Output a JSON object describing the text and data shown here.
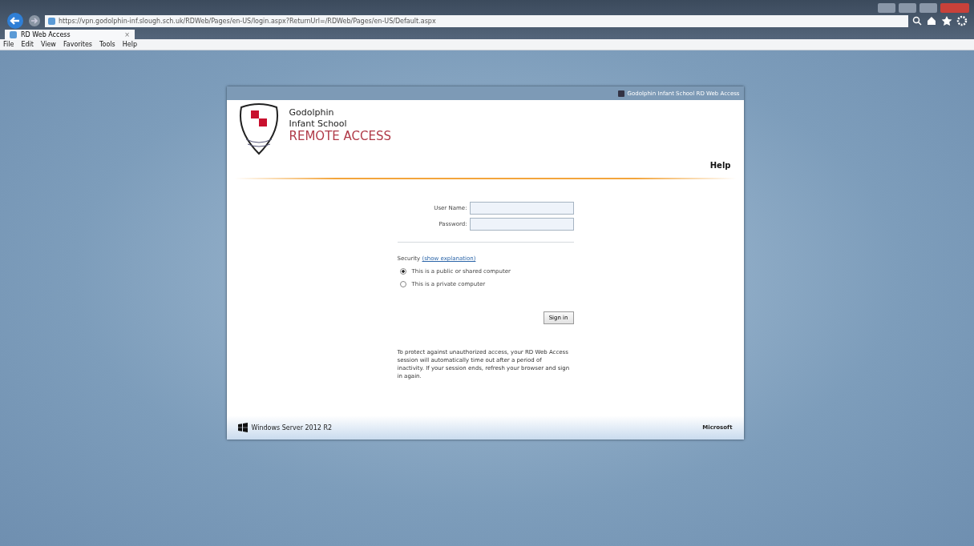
{
  "browser": {
    "url": "https://vpn.godolphin-inf.slough.sch.uk/RDWeb/Pages/en-US/login.aspx?ReturnUrl=/RDWeb/Pages/en-US/Default.aspx",
    "tabs": [
      {
        "label": "RD Web Access",
        "close": "×",
        "selected": true
      }
    ],
    "menu": [
      "File",
      "Edit",
      "View",
      "Favorites",
      "Tools",
      "Help"
    ]
  },
  "page": {
    "header_title": "Godolphin Infant School RD Web Access",
    "logo_lines": [
      "Godolphin",
      "Infant School"
    ],
    "logo_tagline": "REMOTE ACCESS",
    "help": "Help",
    "fields": [
      {
        "label": "User Name:"
      },
      {
        "label": "Password:"
      }
    ],
    "security_label": "Security",
    "security_link": "(show explanation)",
    "options": [
      {
        "label": "This is a public or shared computer",
        "selected": true
      },
      {
        "label": "This is a private computer",
        "selected": false
      }
    ],
    "sign_in": "Sign in",
    "notice": "To protect against unauthorized access, your RD Web Access session will automatically time out after a period of inactivity. If your session ends, refresh your browser and sign in again.",
    "footer_left": "Windows Server 2012 R2",
    "footer_right": "Microsoft"
  }
}
